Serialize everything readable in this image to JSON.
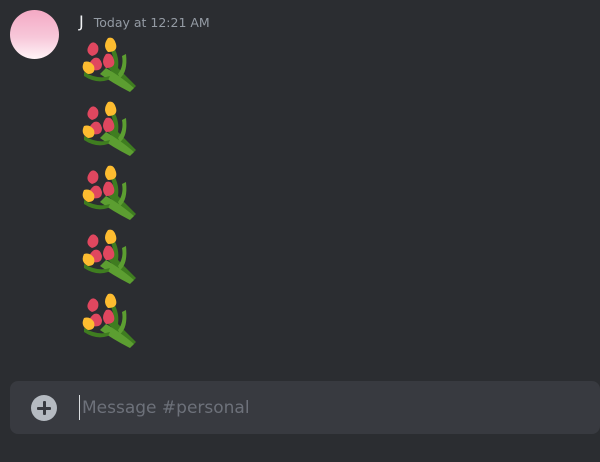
{
  "message": {
    "author": "J",
    "timestamp": "Today at 12:21 AM",
    "emojis": [
      "bouquet",
      "bouquet",
      "bouquet",
      "bouquet",
      "bouquet"
    ]
  },
  "composer": {
    "placeholder": "Message #personal",
    "value": "",
    "add_icon": "plus-circle-icon"
  },
  "colors": {
    "background": "#2b2d31",
    "composer_bg": "#383a40",
    "username": "#f2f3f5",
    "timestamp": "#949ba4",
    "placeholder": "#6d717a"
  }
}
